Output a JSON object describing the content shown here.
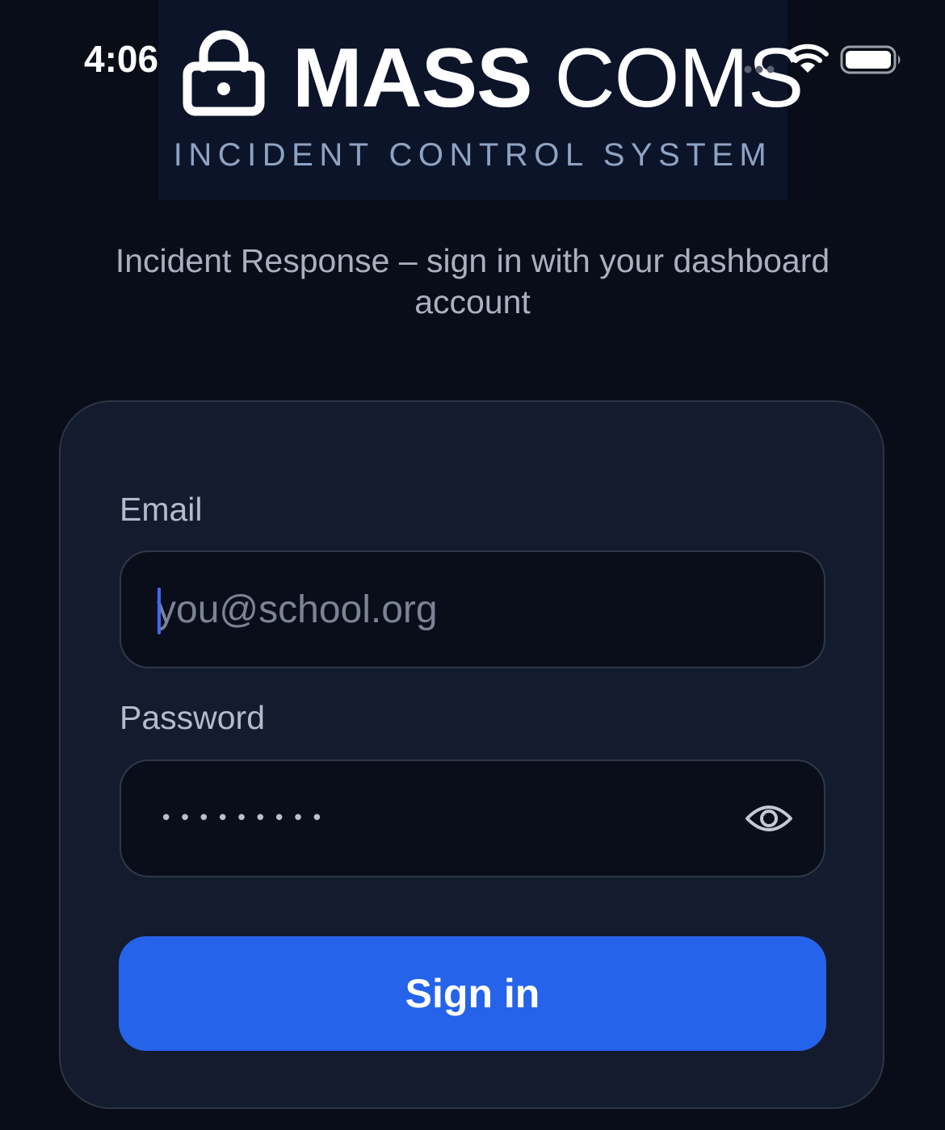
{
  "status_bar": {
    "time": "4:06"
  },
  "brand": {
    "name_bold": "MASS",
    "name_light": "COMS",
    "subtitle": "INCIDENT CONTROL SYSTEM",
    "icon": "lock-icon"
  },
  "tagline": "Incident Response – sign in with your dashboard account",
  "form": {
    "email": {
      "label": "Email",
      "placeholder": "you@school.org",
      "value": ""
    },
    "password": {
      "label": "Password",
      "masked_value": "•••••••••",
      "toggle_icon": "eye-icon"
    },
    "submit_label": "Sign in"
  },
  "colors": {
    "background": "#090d18",
    "card": "#141b2e",
    "accent": "#2563eb",
    "banner": "#0b1429"
  }
}
